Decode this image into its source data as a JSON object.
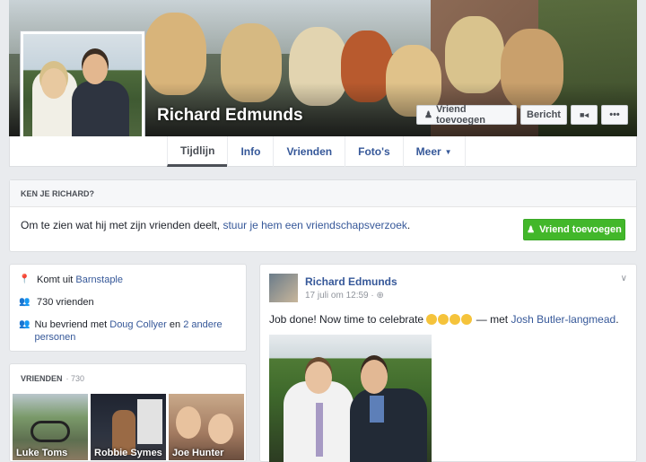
{
  "profile": {
    "name": "Richard Edmunds"
  },
  "cover_buttons": {
    "add_friend": "Vriend toevoegen",
    "message": "Bericht",
    "more": "•••"
  },
  "tabs": [
    {
      "label": "Tijdlijn"
    },
    {
      "label": "Info"
    },
    {
      "label": "Vrienden"
    },
    {
      "label": "Foto's"
    },
    {
      "label": "Meer"
    }
  ],
  "ken_je": {
    "heading": "KEN JE RICHARD?",
    "text": "Om te zien wat hij met zijn vrienden deelt, ",
    "link": "stuur je hem een vriendschapsverzoek",
    "text_end": ".",
    "button": "Vriend toevoegen"
  },
  "intro": {
    "from_prefix": "Komt uit ",
    "from_place": "Barnstaple",
    "friends_count": "730 vrienden",
    "friends_with_prefix": "Nu bevriend met ",
    "friends_with_name": "Doug Collyer",
    "friends_with_mid": " en ",
    "friends_with_others": "2 andere personen"
  },
  "friends_box": {
    "heading": "VRIENDEN",
    "count": "· 730",
    "items": [
      {
        "label": "Luke Toms"
      },
      {
        "label": "Robbie Symes"
      },
      {
        "label": "Joe Hunter"
      }
    ]
  },
  "post": {
    "author": "Richard Edmunds",
    "time": "17 juli om 12:59 · ",
    "privacy_icon": "globe-icon",
    "text": "Job done! Now time to celebrate ",
    "with_text": " — met ",
    "with_name": "Josh Butler-langmead",
    "with_end": "."
  },
  "colors": {
    "link": "#365899",
    "green": "#42b72a",
    "bg": "#e9ebee"
  }
}
